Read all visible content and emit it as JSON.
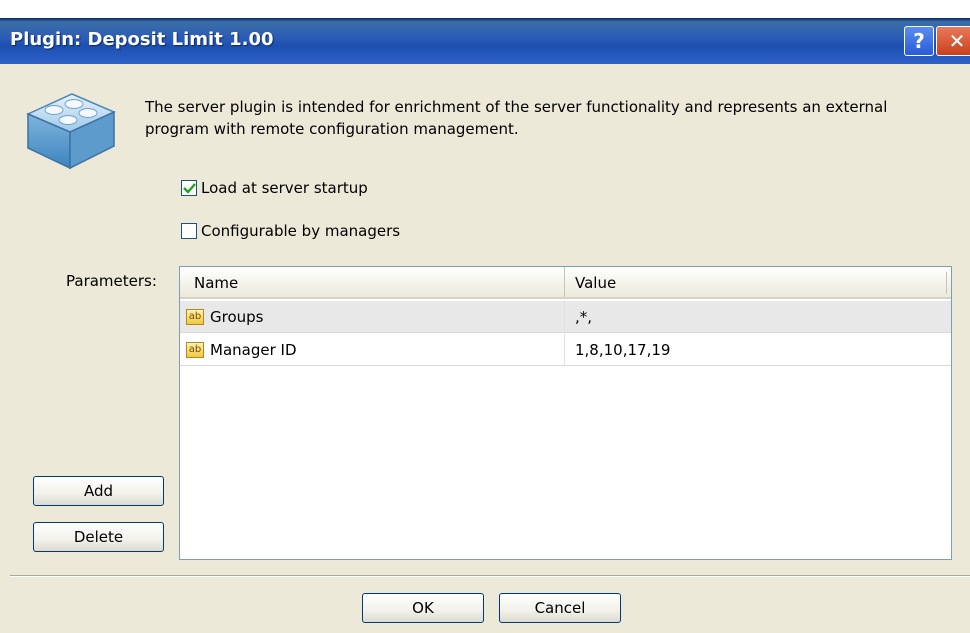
{
  "window": {
    "title": "Plugin: Deposit Limit 1.00",
    "help_label": "?",
    "close_label": "✕"
  },
  "description": "The server plugin is intended for enrichment of the server functionality and represents an external program with remote configuration management.",
  "options": {
    "load_at_startup": {
      "label": "Load at server startup",
      "checked": true
    },
    "configurable_by_managers": {
      "label": "Configurable by managers",
      "checked": false
    }
  },
  "parameters": {
    "label": "Parameters:",
    "columns": [
      "Name",
      "Value"
    ],
    "rows": [
      {
        "icon": "string-param-icon",
        "icon_text": "ab",
        "name": "Groups",
        "value": ",*,"
      },
      {
        "icon": "string-param-icon",
        "icon_text": "ab",
        "name": "Manager ID",
        "value": "1,8,10,17,19"
      }
    ]
  },
  "buttons": {
    "add": "Add",
    "delete": "Delete",
    "ok": "OK",
    "cancel": "Cancel"
  },
  "colors": {
    "titlebar": "#2a5bb8",
    "dialog_bg": "#ece9d8",
    "selected_row": "#e8e8e8",
    "check_mark": "#21a121"
  }
}
